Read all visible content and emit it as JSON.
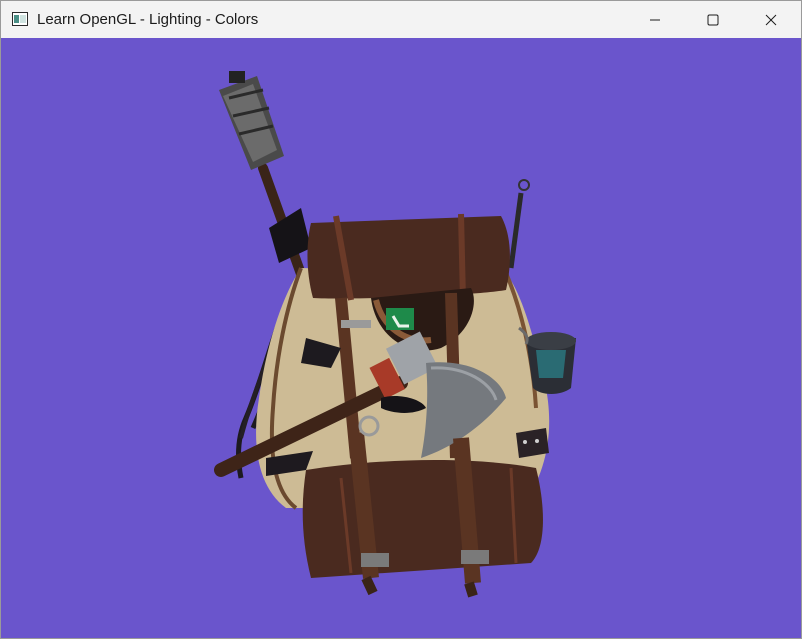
{
  "window": {
    "title": "Learn OpenGL - Lighting - Colors",
    "icon": "opengl-app-icon",
    "controls": {
      "minimize_icon": "minimize-icon",
      "maximize_icon": "maximize-icon",
      "close_icon": "close-icon"
    }
  },
  "viewport": {
    "clear_color": "#6a55cc",
    "scene_object": "backpack-model"
  }
}
